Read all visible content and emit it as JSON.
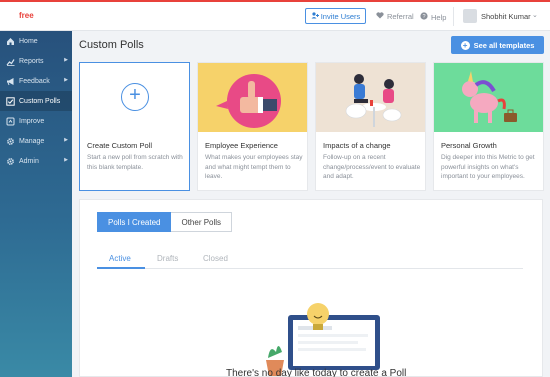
{
  "header": {
    "brand": "free",
    "invite_label": "Invite Users",
    "referral_label": "Referral",
    "help_label": "Help",
    "user_name": "Shobhit Kumar"
  },
  "sidebar": {
    "items": [
      {
        "label": "Home",
        "icon": "home-icon"
      },
      {
        "label": "Reports",
        "icon": "chart-icon"
      },
      {
        "label": "Feedback",
        "icon": "megaphone-icon"
      },
      {
        "label": "Custom Polls",
        "icon": "checkbox-icon"
      },
      {
        "label": "Improve",
        "icon": "improve-icon"
      },
      {
        "label": "Manage",
        "icon": "gear-icon"
      },
      {
        "label": "Admin",
        "icon": "gear-icon"
      }
    ]
  },
  "main": {
    "title": "Custom Polls",
    "see_all_label": "See all templates",
    "cards": [
      {
        "title": "Create Custom Poll",
        "desc": "Start a new poll from scratch with this blank template."
      },
      {
        "title": "Employee Experience",
        "desc": "What makes your employees stay and what might tempt them to leave."
      },
      {
        "title": "Impacts of a change",
        "desc": "Follow-up on a recent change/process/event to evaluate and adapt."
      },
      {
        "title": "Personal Growth",
        "desc": "Dig deeper into this Metric to get powerful insights on what's important to your employees."
      }
    ],
    "toggle": [
      "Polls I Created",
      "Other Polls"
    ],
    "tabs": [
      "Active",
      "Drafts",
      "Closed"
    ],
    "empty_text": "There's no day like today to create a Poll"
  },
  "colors": {
    "accent": "#4a90e2",
    "brand": "#e8413b",
    "sidebar": "#2e6b93"
  }
}
